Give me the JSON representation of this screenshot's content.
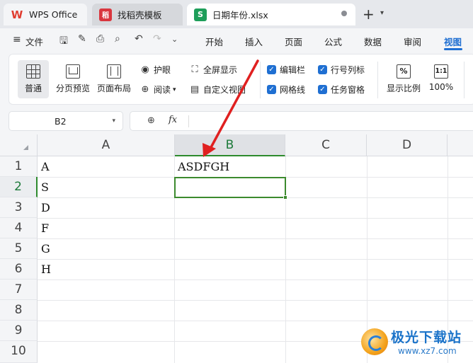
{
  "tabs": [
    {
      "label": "WPS Office",
      "logo": "W"
    },
    {
      "label": "找稻壳模板",
      "logo": "稻"
    },
    {
      "label": "日期年份.xlsx",
      "logo": "S"
    }
  ],
  "menubar": {
    "file_label": "文件",
    "tabs": [
      "开始",
      "插入",
      "页面",
      "公式",
      "数据",
      "审阅",
      "视图"
    ],
    "active_tab": "视图"
  },
  "ribbon": {
    "normal": "普通",
    "page_break_preview": "分页预览",
    "page_layout": "页面布局",
    "eye_protection": "护眼",
    "reading": "阅读",
    "full_screen": "全屏显示",
    "custom_view": "自定义视图",
    "checkboxes": [
      {
        "label": "编辑栏",
        "checked": true
      },
      {
        "label": "行号列标",
        "checked": true
      },
      {
        "label": "网格线",
        "checked": true
      },
      {
        "label": "任务窗格",
        "checked": true
      }
    ],
    "zoom_ratio": "显示比例",
    "zoom_100": "100%",
    "zoom_ratio_icon": "%",
    "zoom_100_icon": "1:1"
  },
  "formula_bar": {
    "name_box": "B2",
    "fx_label": "fx",
    "formula": ""
  },
  "sheet": {
    "columns": [
      "A",
      "B",
      "C",
      "D"
    ],
    "rows": [
      "1",
      "2",
      "3",
      "4",
      "5",
      "6",
      "7",
      "8",
      "9",
      "10"
    ],
    "selected_cell": "B2",
    "cells": {
      "A1": "A",
      "A2": "S",
      "A3": "D",
      "A4": "F",
      "A5": "G",
      "A6": "H",
      "B1": "ASDFGH"
    }
  },
  "annotation": {
    "arrow_color": "#e02020"
  },
  "watermark": {
    "title": "极光下载站",
    "url": "www.xz7.com"
  },
  "colors": {
    "accent": "#1f6fd2",
    "selection": "#3c8a2e",
    "sheet_icon": "#1e9e5a"
  }
}
